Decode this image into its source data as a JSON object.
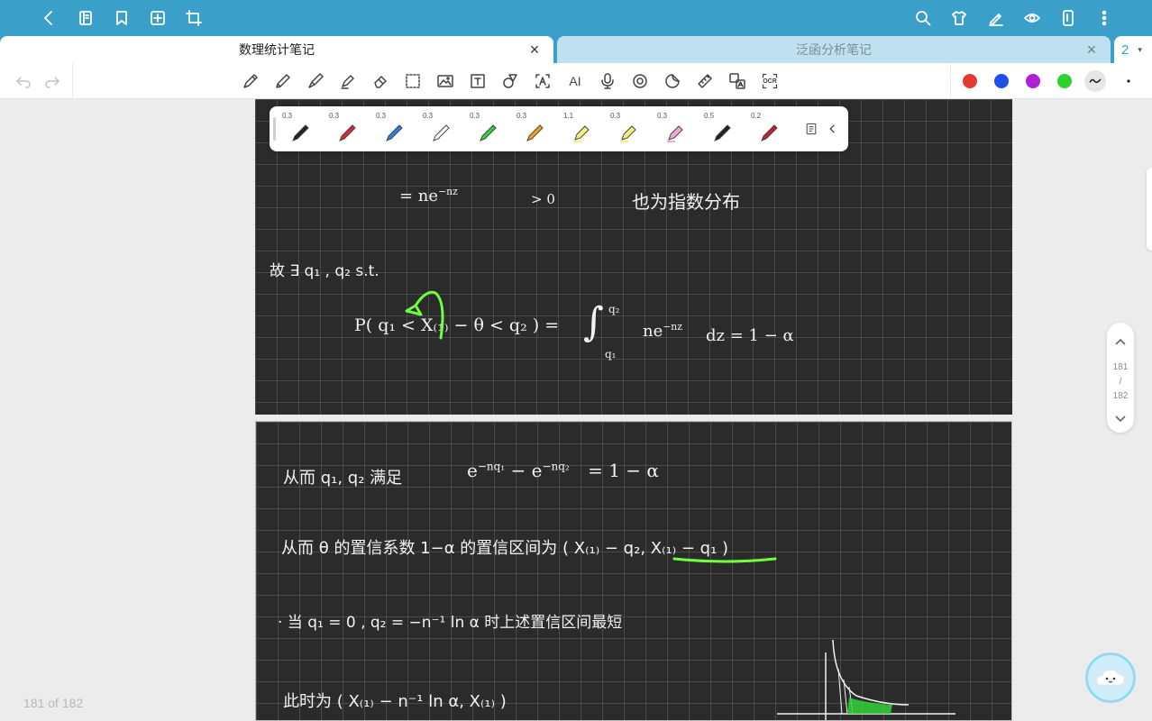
{
  "tabs": [
    {
      "label": "数理统计笔记",
      "active": true
    },
    {
      "label": "泛函分析笔记",
      "active": false
    }
  ],
  "tab_count": "2",
  "page_indicator": {
    "current": "181",
    "divider": "/",
    "total": "182"
  },
  "page_count_text": "181 of 182",
  "colors": {
    "topbar": "#3aa0c9",
    "red": "#e53935",
    "blue": "#1e4fe6",
    "purple": "#b21fd9",
    "green": "#2ed12e",
    "highlight_green": "#6fff3e"
  },
  "pens": [
    {
      "size": "0.3",
      "color": "#222222"
    },
    {
      "size": "0.3",
      "color": "#d6283c"
    },
    {
      "size": "0.3",
      "color": "#2f7de0"
    },
    {
      "size": "0.3",
      "color": "#ffffff"
    },
    {
      "size": "0.3",
      "color": "#32d13a"
    },
    {
      "size": "0.3",
      "color": "#f0a21e"
    },
    {
      "size": "1.1",
      "color": "#f4f07a"
    },
    {
      "size": "0.3",
      "color": "#f7f17a"
    },
    {
      "size": "0.3",
      "color": "#f3a6d6"
    },
    {
      "size": "0.5",
      "color": "#222222"
    },
    {
      "size": "0.2",
      "color": "#c4202f"
    }
  ],
  "toolbar": {
    "ocr_label": "OCR",
    "ai_label": "AI",
    "text_tool_label": "T"
  },
  "notes": {
    "page1": {
      "line1": "= ne",
      "line1_exp": "−nz",
      "line1_gt": "> 0",
      "line1_text": "也为指数分布",
      "line2": "故 ∃ q₁ , q₂   s.t.",
      "line3_lhs": "P( q₁ <  X₍₁₎ − θ  < q₂ ) =",
      "line3_int_top": "q₂",
      "line3_int_bottom": "q₁",
      "line3_rhs": "ne",
      "line3_rhs_exp": "−nz",
      "line3_tail": "dz = 1 − α"
    },
    "page2": {
      "line1": "从而 q₁, q₂ 满足",
      "line1_math": "e",
      "line1_exp1": "−nq₁",
      "line1_mid": "− e",
      "line1_exp2": "−nq₂",
      "line1_end": "= 1 − α",
      "line2": "从而 θ 的置信系数 1−α 的置信区间为 ( X₍₁₎ − q₂,  X₍₁₎ − q₁ )",
      "line3": "·  当 q₁ = 0 ,  q₂ = −n⁻¹ ln α  时上述置信区间最短",
      "line4": "此时为 ( X₍₁₎ − n⁻¹ ln α,  X₍₁₎ )"
    }
  }
}
